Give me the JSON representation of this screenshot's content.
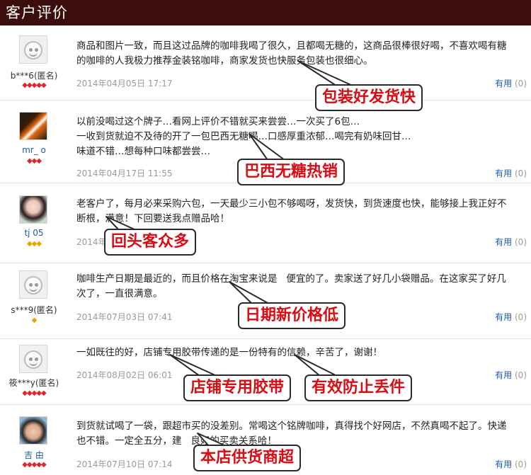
{
  "header": {
    "title": "客户评价"
  },
  "useful_label": "有用",
  "reviews": [
    {
      "user": "b***6(匿名)",
      "rank": "◆◆◆◆◆",
      "content": "商品和图片一致，而且这过品牌的咖啡我喝了很久，且都喝无糖的，这商品很棒很好喝，不喜欢喝有糖\n的咖啡的人我极力推荐金装铭咖啡，商家发货也快服务包装也很细心。",
      "time": "2014年04月05日 17:17",
      "useful_count": "(0)",
      "callout": "包装好发货快"
    },
    {
      "user": "mr_  o",
      "rank": "◆◆◆",
      "content": "以前没喝过这个牌子…看网上评价不错就买来尝尝…一次买了6包…\n一收到货就迫不及待的开了一包巴西无糖喝…口感厚重浓郁…喝完有奶味回甘…\n味道不错…想每种口味都尝尝…",
      "time": "2014年04月17日 11:55",
      "useful_count": "(0)",
      "callout": "巴西无糖热销"
    },
    {
      "user": "tj   05",
      "rank": "◆◆◆",
      "content": "老客户了，每月必来采购六包，一天最少三小包不够喝呀，发货快，到货速度也快，能够接上我正好不\n断根，满意！下回要送我点赠品哈！",
      "time": "2014年",
      "useful_count": "(0)",
      "callout": "回头客众多"
    },
    {
      "user": "s***9(匿名)",
      "rank": "◆",
      "content": "咖啡生产日期是最近的，而且价格在淘宝来说是   便宜的了。卖家送了好几小袋赠品。在这家买了好几\n次了，一直很满意。",
      "time": "2014年07月03日 07:41",
      "useful_count": "(0)",
      "callout": "日期新价格低"
    },
    {
      "user": "筱***y(匿名)",
      "rank": "◆◆◆◆◆",
      "content": "一如既往的好，店铺专用胶带传递的是一份特有的信赖，辛苦了，谢谢！",
      "time": "2014年08月02日 06:01",
      "useful_count": "(0)",
      "callout": "店铺专用胶带",
      "callout2": "有效防止丢件"
    },
    {
      "user": "吉   由",
      "rank": "◆◆◆◆◆",
      "content": "到货就试喝了一袋，跟超市买的没差别。常喝这个铭牌咖啡，真得找个好网店，不然真喝不起了。快递\n也不错。一定全五分，建   良好的买卖关系哈！",
      "time": "2014年07月10日 07:14",
      "useful_count": "(0)",
      "callout": "本店供货商超"
    }
  ]
}
